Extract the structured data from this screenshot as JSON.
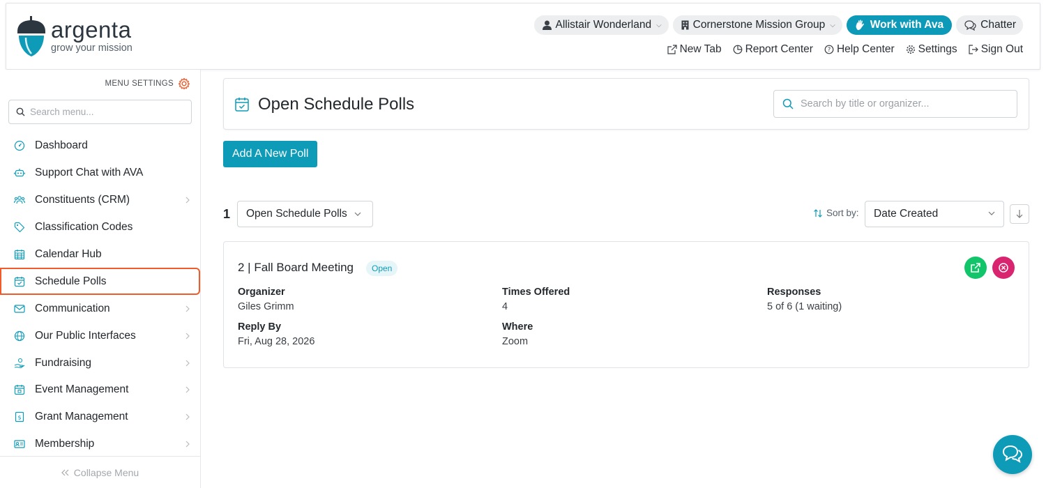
{
  "brand": {
    "name": "argenta",
    "tagline": "grow your mission"
  },
  "header": {
    "user": "Allistair Wonderland",
    "organization": "Cornerstone Mission Group",
    "work_with_ava": "Work with Ava",
    "chatter": "Chatter",
    "links": {
      "new_tab": "New Tab",
      "report_center": "Report Center",
      "help_center": "Help Center",
      "settings": "Settings",
      "sign_out": "Sign Out"
    }
  },
  "sidebar": {
    "menu_settings": "MENU SETTINGS",
    "search_placeholder": "Search menu...",
    "items": [
      {
        "label": "Dashboard",
        "icon": "dashboard-icon",
        "has_submenu": false
      },
      {
        "label": "Support Chat with AVA",
        "icon": "robot-icon",
        "has_submenu": false
      },
      {
        "label": "Constituents (CRM)",
        "icon": "people-icon",
        "has_submenu": true
      },
      {
        "label": "Classification Codes",
        "icon": "tag-icon",
        "has_submenu": false
      },
      {
        "label": "Calendar Hub",
        "icon": "calendar-icon",
        "has_submenu": false
      },
      {
        "label": "Schedule Polls",
        "icon": "calendar-check-icon",
        "has_submenu": false,
        "active": true
      },
      {
        "label": "Communication",
        "icon": "mail-icon",
        "has_submenu": true
      },
      {
        "label": "Our Public Interfaces",
        "icon": "globe-icon",
        "has_submenu": true
      },
      {
        "label": "Fundraising",
        "icon": "hand-donate-icon",
        "has_submenu": true
      },
      {
        "label": "Event Management",
        "icon": "event-calendar-icon",
        "has_submenu": true
      },
      {
        "label": "Grant Management",
        "icon": "grant-document-icon",
        "has_submenu": true
      },
      {
        "label": "Membership",
        "icon": "id-card-icon",
        "has_submenu": true
      }
    ],
    "collapse": "Collapse Menu"
  },
  "main": {
    "title": "Open Schedule Polls",
    "search_placeholder": "Search by title or organizer...",
    "add_button": "Add A New Poll",
    "count": "1",
    "filter_value": "Open Schedule Polls",
    "sort_label": "Sort by:",
    "sort_value": "Date Created"
  },
  "polls": [
    {
      "title": "2 | Fall Board Meeting",
      "status": "Open",
      "organizer_label": "Organizer",
      "organizer": "Giles Grimm",
      "times_label": "Times Offered",
      "times": "4",
      "responses_label": "Responses",
      "responses": "5 of 6 (1 waiting)",
      "reply_label": "Reply By",
      "reply_by": "Fri, Aug 28, 2026",
      "where_label": "Where",
      "where": "Zoom"
    }
  ],
  "colors": {
    "accent": "#0d9bb8",
    "active_outline": "#ef5b2a",
    "open_action": "#12c46a",
    "close_action": "#d9256f"
  }
}
